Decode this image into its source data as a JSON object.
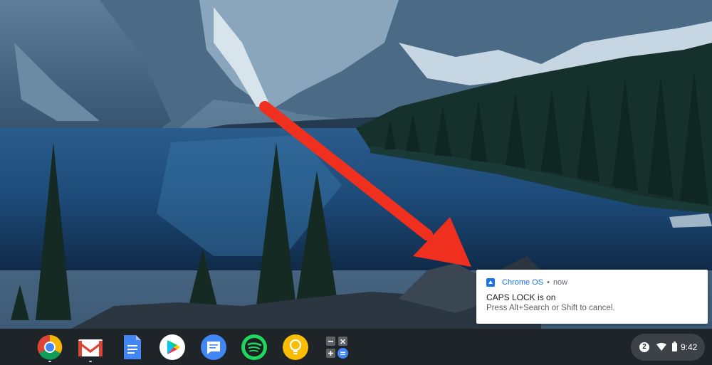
{
  "notification": {
    "app_name": "Chrome OS",
    "separator": "•",
    "time": "now",
    "title": "CAPS LOCK is on",
    "message": "Press Alt+Search or Shift to cancel."
  },
  "shelf": {
    "apps": [
      {
        "name": "chrome",
        "icon": "chrome-icon",
        "running": true
      },
      {
        "name": "gmail",
        "icon": "gmail-icon",
        "running": true
      },
      {
        "name": "google-docs",
        "icon": "docs-icon",
        "running": false
      },
      {
        "name": "play-store",
        "icon": "play-store-icon",
        "running": false
      },
      {
        "name": "messages",
        "icon": "messages-icon",
        "running": false
      },
      {
        "name": "spotify",
        "icon": "spotify-icon",
        "running": false
      },
      {
        "name": "keep",
        "icon": "keep-icon",
        "running": false
      },
      {
        "name": "calculator",
        "icon": "calculator-icon",
        "running": false
      }
    ]
  },
  "status_tray": {
    "notification_count": "2",
    "time": "9:42",
    "wifi_icon": "wifi-icon",
    "battery_icon": "battery-icon"
  },
  "wallpaper": {
    "annotation": "red-arrow-pointing-to-notification"
  },
  "colors": {
    "shelf": "#1f2429",
    "tray": "#3c4248",
    "accent_blue": "#1a73e8",
    "arrow_red": "#f0301e"
  }
}
